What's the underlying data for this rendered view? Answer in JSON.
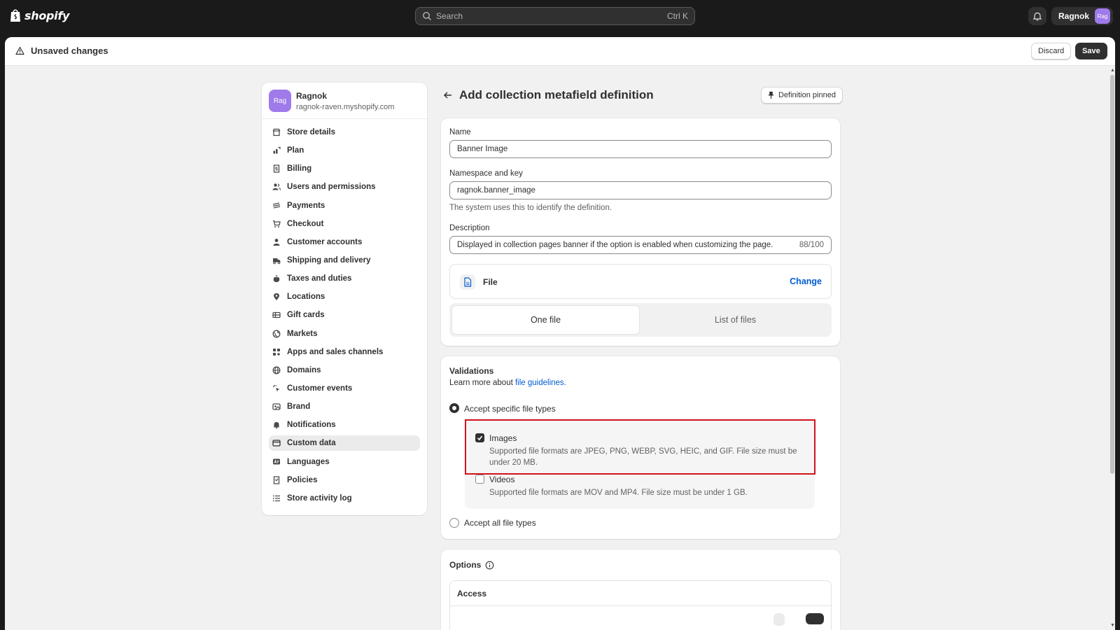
{
  "topbar": {
    "logo_text": "shopify",
    "search_placeholder": "Search",
    "search_shortcut": "Ctrl K",
    "account_name": "Ragnok",
    "account_avatar": "Rag"
  },
  "unsaved_bar": {
    "title": "Unsaved changes",
    "discard_label": "Discard",
    "save_label": "Save"
  },
  "store": {
    "avatar": "Rag",
    "name": "Ragnok",
    "url": "ragnok-raven.myshopify.com"
  },
  "sidebar": {
    "items": [
      {
        "label": "Store details",
        "icon": "store-icon"
      },
      {
        "label": "Plan",
        "icon": "plan-icon"
      },
      {
        "label": "Billing",
        "icon": "billing-icon"
      },
      {
        "label": "Users and permissions",
        "icon": "users-icon"
      },
      {
        "label": "Payments",
        "icon": "payments-icon"
      },
      {
        "label": "Checkout",
        "icon": "cart-icon"
      },
      {
        "label": "Customer accounts",
        "icon": "person-icon"
      },
      {
        "label": "Shipping and delivery",
        "icon": "truck-icon"
      },
      {
        "label": "Taxes and duties",
        "icon": "tax-icon"
      },
      {
        "label": "Locations",
        "icon": "location-icon"
      },
      {
        "label": "Gift cards",
        "icon": "gift-card-icon"
      },
      {
        "label": "Markets",
        "icon": "globe-icon"
      },
      {
        "label": "Apps and sales channels",
        "icon": "apps-icon"
      },
      {
        "label": "Domains",
        "icon": "domain-icon"
      },
      {
        "label": "Customer events",
        "icon": "cursor-icon"
      },
      {
        "label": "Brand",
        "icon": "brand-icon"
      },
      {
        "label": "Notifications",
        "icon": "bell-icon"
      },
      {
        "label": "Custom data",
        "icon": "custom-data-icon",
        "active": true
      },
      {
        "label": "Languages",
        "icon": "language-icon"
      },
      {
        "label": "Policies",
        "icon": "policy-icon"
      },
      {
        "label": "Store activity log",
        "icon": "list-icon"
      }
    ]
  },
  "page": {
    "title": "Add collection metafield definition",
    "pinned_label": "Definition pinned"
  },
  "definition": {
    "name_label": "Name",
    "name_value": "Banner Image",
    "namespace_label": "Namespace and key",
    "namespace_value": "ragnok.banner_image",
    "namespace_help": "The system uses this to identify the definition.",
    "description_label": "Description",
    "description_value": "Displayed in collection pages banner if the option is enabled when customizing the page.",
    "description_counter": "88/100",
    "type_label": "File",
    "change_label": "Change",
    "seg_one": "One file",
    "seg_list": "List of files"
  },
  "validations": {
    "title": "Validations",
    "learn_prefix": "Learn more about ",
    "learn_link": "file guidelines.",
    "specific_label": "Accept specific file types",
    "images_label": "Images",
    "images_desc": "Supported file formats are JPEG, PNG, WEBP, SVG, HEIC, and GIF. File size must be under 20 MB.",
    "images_checked": true,
    "videos_label": "Videos",
    "videos_desc": "Supported file formats are MOV and MP4. File size must be under 1 GB.",
    "videos_checked": false,
    "all_label": "Accept all file types"
  },
  "options": {
    "title": "Options",
    "access_label": "Access"
  },
  "colors": {
    "accent_link": "#005bd3",
    "highlight": "#d1131d",
    "avatar": "#9f7aea"
  }
}
